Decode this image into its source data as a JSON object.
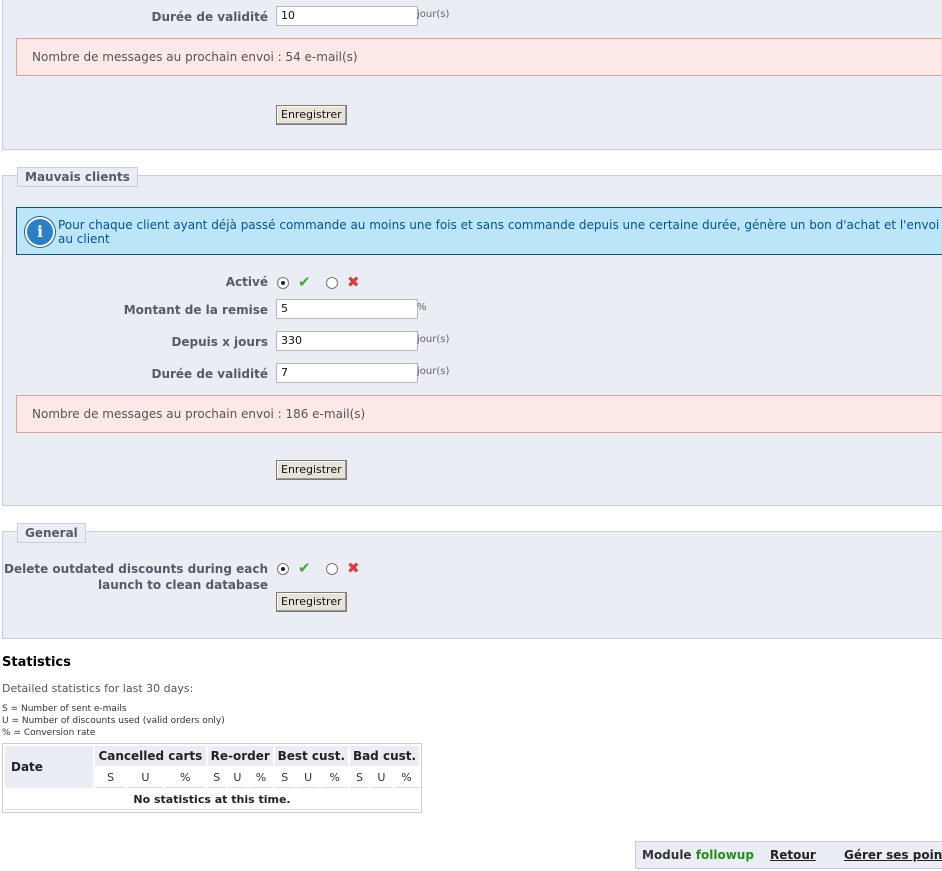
{
  "top_section": {
    "validity_label": "Durée de validité",
    "validity_value": "10",
    "validity_unit": "jour(s)",
    "warning": "Nombre de messages au prochain envoi : 54 e-mail(s)",
    "save_label": "Enregistrer"
  },
  "bad_clients": {
    "legend": "Mauvais clients",
    "info": "Pour chaque client ayant déjà passé commande au moins une fois et sans commande depuis une certaine durée, génère un bon d'achat et l'envoi au client",
    "active_label": "Activé",
    "discount_label": "Montant de la remise",
    "discount_value": "5",
    "discount_unit": "%",
    "days_label": "Depuis x jours",
    "days_value": "330",
    "days_unit": "jour(s)",
    "validity_label": "Durée de validité",
    "validity_value": "7",
    "validity_unit": "jour(s)",
    "warning": "Nombre de messages au prochain envoi : 186 e-mail(s)",
    "save_label": "Enregistrer"
  },
  "general": {
    "legend": "General",
    "delete_label_line1": "Delete outdated discounts during each",
    "delete_label_line2": "launch to clean database",
    "save_label": "Enregistrer"
  },
  "statistics": {
    "title": "Statistics",
    "subtitle": "Detailed statistics for last 30 days:",
    "legend_s": "S = Number of sent e-mails",
    "legend_u": "U = Number of discounts used (valid orders only)",
    "legend_pct": "% = Conversion rate",
    "col_date": "Date",
    "groups": [
      "Cancelled carts",
      "Re-order",
      "Best cust.",
      "Bad cust."
    ],
    "sub_cols": [
      "S",
      "U",
      "%"
    ],
    "empty": "No statistics at this time."
  },
  "module_bar": {
    "module_prefix": "Module",
    "module_name": "followup",
    "back": "Retour",
    "manage": "Gérer ses points"
  },
  "colors": {
    "accent_green": "#3fa83a",
    "accent_red": "#e23a3a",
    "info_blue": "#00529b"
  }
}
